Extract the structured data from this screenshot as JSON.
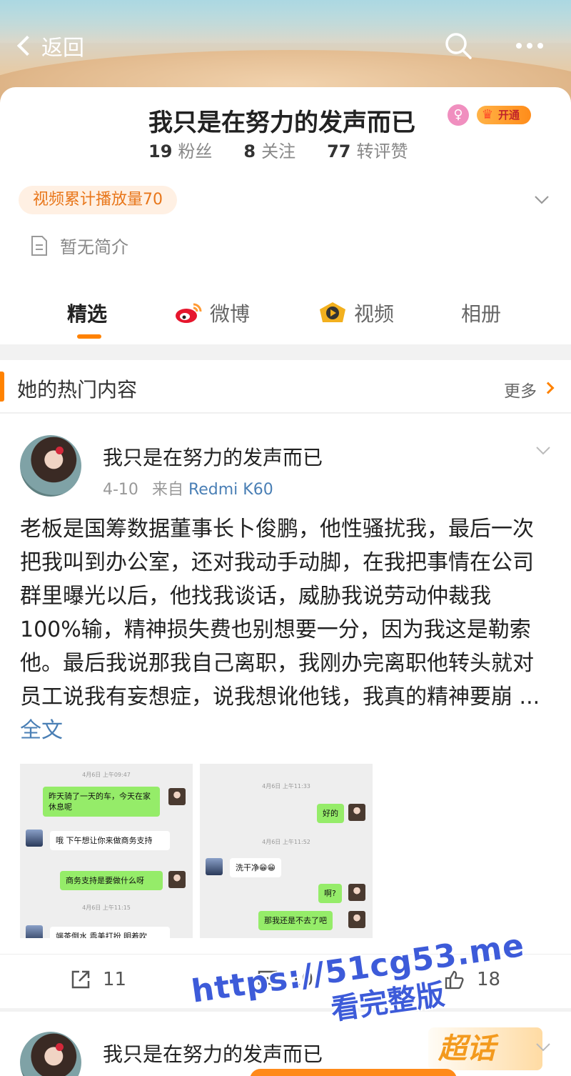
{
  "topbar": {
    "back_label": "返回"
  },
  "profile": {
    "name": "我只是在努力的发声而已",
    "vip_label": "开通",
    "stats": [
      {
        "value": "19",
        "label": "粉丝"
      },
      {
        "value": "8",
        "label": "关注"
      },
      {
        "value": "77",
        "label": "转评赞"
      }
    ],
    "video_count_label": "视频累计播放量70",
    "bio": "暂无简介"
  },
  "tabs": [
    {
      "label": "精选",
      "icon": ""
    },
    {
      "label": "微博",
      "icon": "weibo-icon"
    },
    {
      "label": "视频",
      "icon": "video-icon"
    },
    {
      "label": "相册",
      "icon": ""
    }
  ],
  "hot_section": {
    "title": "她的热门内容",
    "more_label": "更多"
  },
  "post": {
    "author": "我只是在努力的发声而已",
    "date": "4-10",
    "source_prefix": "来自",
    "device": "Redmi K60",
    "text": "老板是国筹数据董事长卜俊鹏，他性骚扰我，最后一次把我叫到办公室，还对我动手动脚，在我把事情在公司群里曝光以后，他找我谈话，威胁我说劳动仲裁我100%输，精神损失费也别想要一分，因为我这是勒索他。最后我说那我自己离职，我刚办完离职他转头就对员工说我有妄想症，说我想讹他钱，我真的精神要崩 ... ",
    "full_text_label": "全文",
    "screenshot1": {
      "time1": "4月6日 上午09:47",
      "msg1": "昨天骑了一天的车，今天在家休息呢",
      "msg2": "哦 下午想让你来做商务支持",
      "msg3": "商务支持是要做什么呀",
      "time2": "4月6日 上午11:15",
      "msg4": "端茶倒水 乖美打扮 明着吹"
    },
    "screenshot2": {
      "time1": "4月6日 上午11:33",
      "msg1": "好的",
      "time2": "4月6日 上午11:52",
      "msg2": "洗干净😁😁",
      "msg3": "啊?",
      "msg4": "那我还是不去了吧"
    },
    "actions": [
      {
        "icon": "share-icon",
        "count": "11"
      },
      {
        "icon": "comment-icon",
        "count": "10"
      },
      {
        "icon": "like-icon",
        "count": "18"
      }
    ]
  },
  "watermark": {
    "line1": "https://51cg53.me",
    "line2": "看完整版"
  },
  "post2": {
    "author": "我只是在努力的发声而已",
    "badge": "超话"
  },
  "colors": {
    "accent": "#ff8200",
    "link": "#4a7fb5",
    "chat_green": "#95ec69"
  }
}
